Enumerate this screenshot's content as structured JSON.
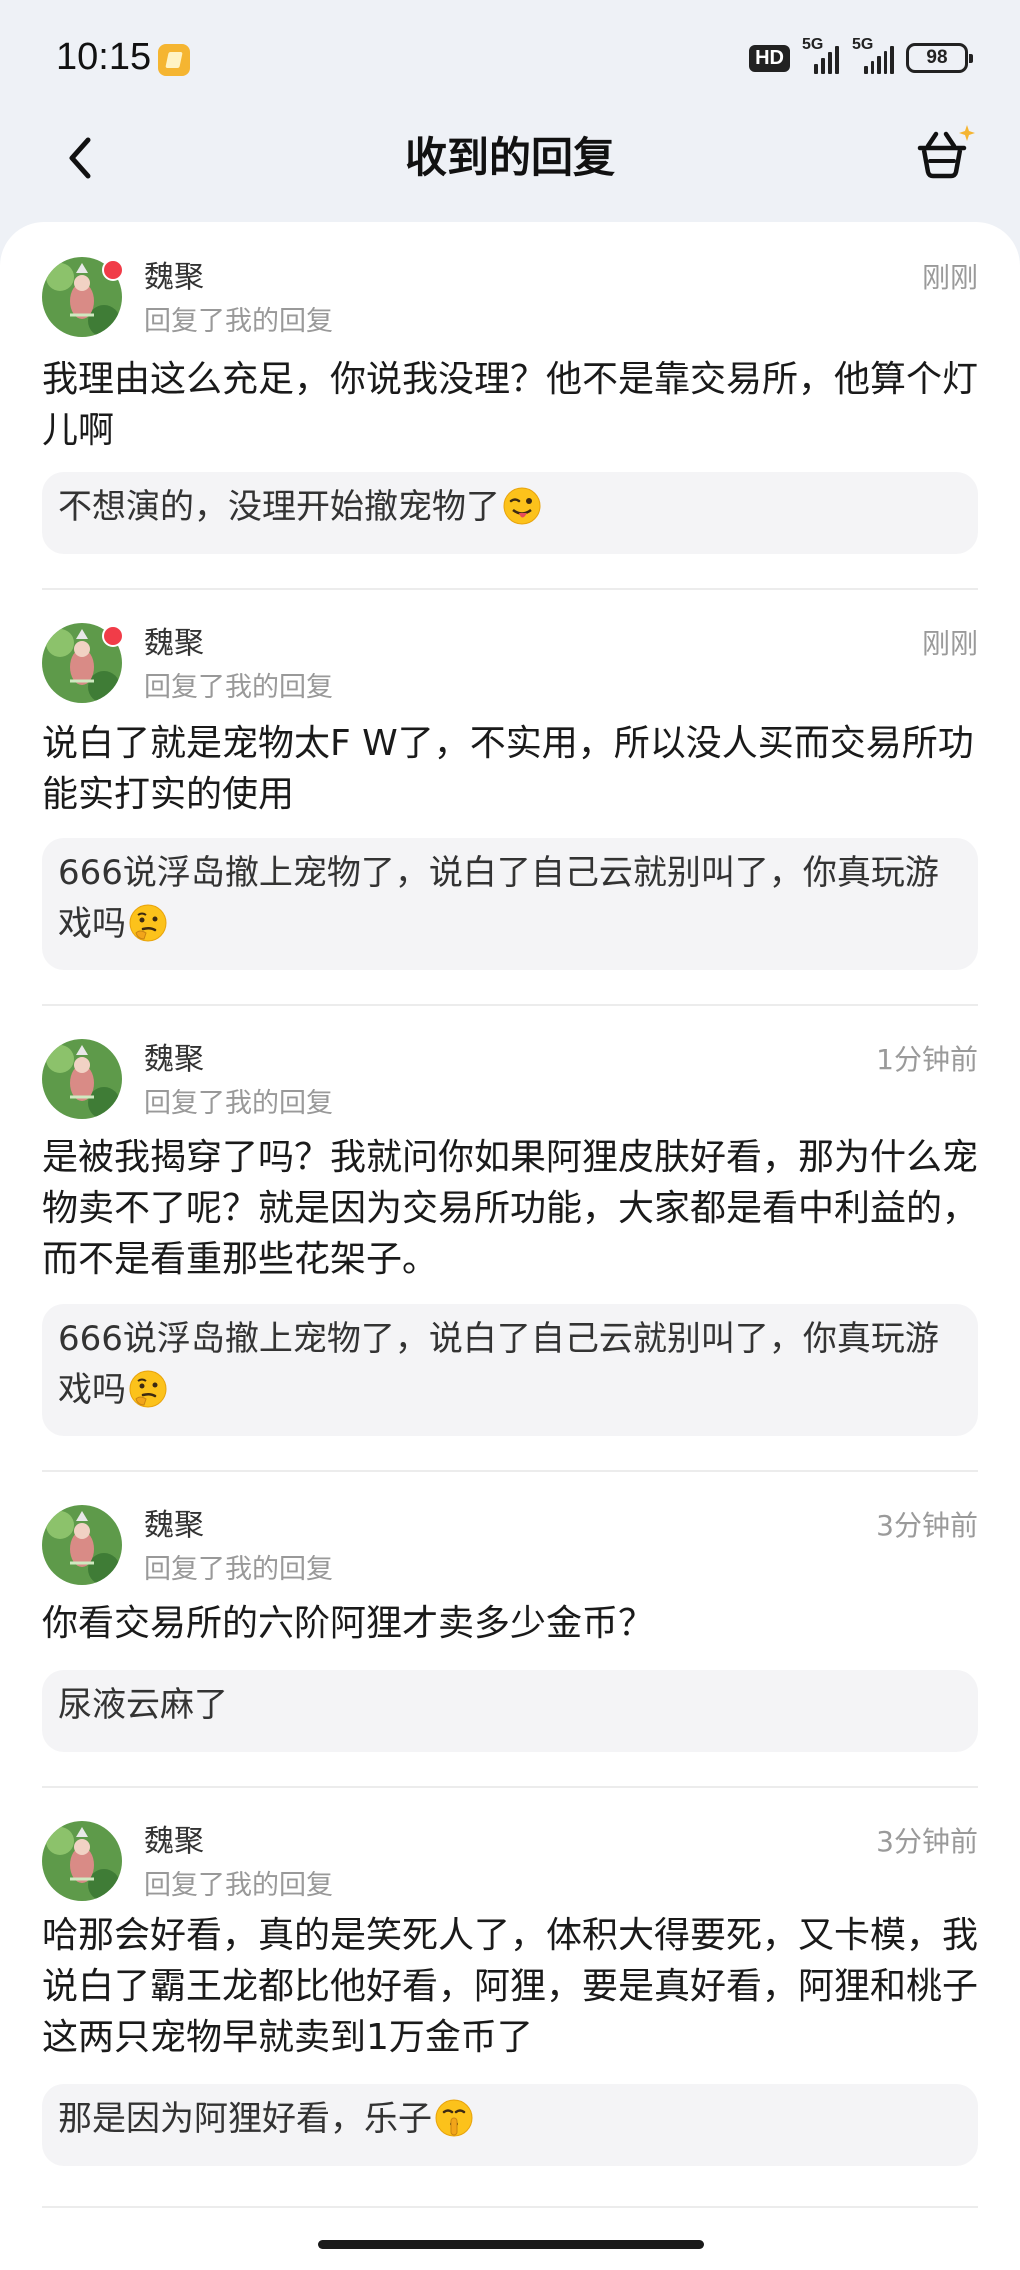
{
  "status_bar": {
    "time": "10:15",
    "hd_label": "HD",
    "signal_1_label": "5G",
    "signal_2_label": "5G",
    "battery": "98"
  },
  "header": {
    "title": "收到的回复"
  },
  "replies": [
    {
      "name": "魏聚",
      "sub": "回复了我的回复",
      "time": "刚刚",
      "unread": true,
      "text": "我理由这么充足，你说我没理？他不是靠交易所，他算个灯儿啊",
      "quote": "不想演的，没理开始撤宠物了",
      "quote_emoji": "winking-tongue-emoji"
    },
    {
      "name": "魏聚",
      "sub": "回复了我的回复",
      "time": "刚刚",
      "unread": true,
      "text": "说白了就是宠物太F W了，不实用，所以没人买而交易所功能实打实的使用",
      "quote": "666说浮岛撤上宠物了，说白了自己云就别叫了，你真玩游戏吗",
      "quote_emoji": "thinking-face-emoji"
    },
    {
      "name": "魏聚",
      "sub": "回复了我的回复",
      "time": "1分钟前",
      "unread": false,
      "text": "是被我揭穿了吗？我就问你如果阿狸皮肤好看，那为什么宠物卖不了呢？就是因为交易所功能，大家都是看中利益的，而不是看重那些花架子。",
      "quote": "666说浮岛撤上宠物了，说白了自己云就别叫了，你真玩游戏吗",
      "quote_emoji": "thinking-face-emoji"
    },
    {
      "name": "魏聚",
      "sub": "回复了我的回复",
      "time": "3分钟前",
      "unread": false,
      "text": "你看交易所的六阶阿狸才卖多少金币？",
      "quote": "尿液云麻了",
      "quote_emoji": ""
    },
    {
      "name": "魏聚",
      "sub": "回复了我的回复",
      "time": "3分钟前",
      "unread": false,
      "text": "哈那会好看，真的是笑死人了，体积大得要死，又卡模，我说白了霸王龙都比他好看，阿狸，要是真好看，阿狸和桃子这两只宠物早就卖到1万金币了",
      "quote": "那是因为阿狸好看，乐子",
      "quote_emoji": "shushing-face-emoji"
    }
  ]
}
